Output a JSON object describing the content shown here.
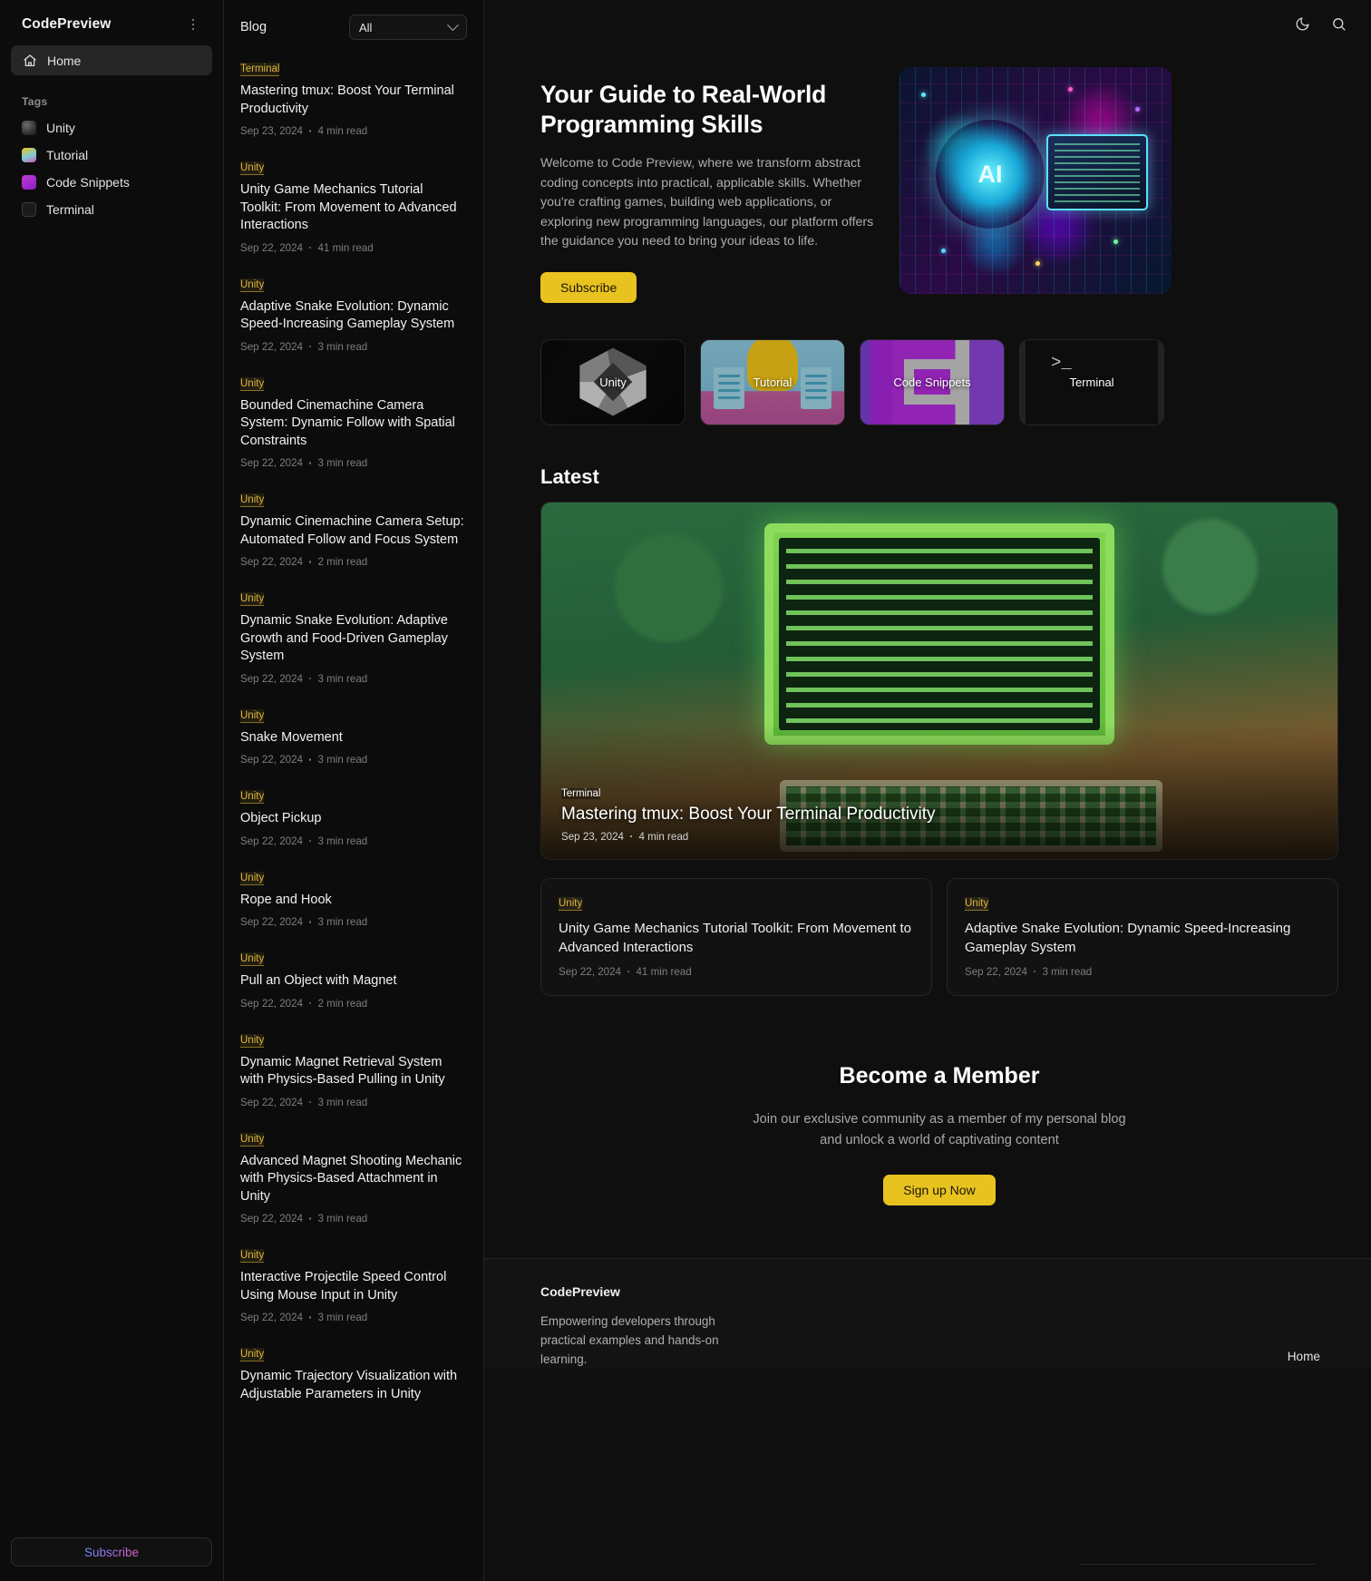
{
  "sidebar": {
    "brand": "CodePreview",
    "menu_icon": "kebab-menu-icon",
    "nav": [
      {
        "label": "Home",
        "icon": "home-icon",
        "active": true
      }
    ],
    "tags_header": "Tags",
    "tags": [
      {
        "label": "Unity",
        "icon": "unity-logo-icon"
      },
      {
        "label": "Tutorial",
        "icon": "tutorial-book-icon"
      },
      {
        "label": "Code Snippets",
        "icon": "code-snippets-icon"
      },
      {
        "label": "Terminal",
        "icon": "terminal-icon"
      }
    ],
    "subscribe_label": "Subscribe"
  },
  "list": {
    "title": "Blog",
    "filter_value": "All",
    "posts": [
      {
        "tag": "Terminal",
        "title": "Mastering tmux: Boost Your Terminal Productivity",
        "date": "Sep 23, 2024",
        "read": "4 min read"
      },
      {
        "tag": "Unity",
        "title": "Unity Game Mechanics Tutorial Toolkit: From Movement to Advanced Interactions",
        "date": "Sep 22, 2024",
        "read": "41 min read"
      },
      {
        "tag": "Unity",
        "title": "Adaptive Snake Evolution: Dynamic Speed-Increasing Gameplay System",
        "date": "Sep 22, 2024",
        "read": "3 min read"
      },
      {
        "tag": "Unity",
        "title": "Bounded Cinemachine Camera System: Dynamic Follow with Spatial Constraints",
        "date": "Sep 22, 2024",
        "read": "3 min read"
      },
      {
        "tag": "Unity",
        "title": "Dynamic Cinemachine Camera Setup: Automated Follow and Focus System",
        "date": "Sep 22, 2024",
        "read": "2 min read"
      },
      {
        "tag": "Unity",
        "title": "Dynamic Snake Evolution: Adaptive Growth and Food-Driven Gameplay System",
        "date": "Sep 22, 2024",
        "read": "3 min read"
      },
      {
        "tag": "Unity",
        "title": "Snake Movement",
        "date": "Sep 22, 2024",
        "read": "3 min read"
      },
      {
        "tag": "Unity",
        "title": "Object Pickup",
        "date": "Sep 22, 2024",
        "read": "3 min read"
      },
      {
        "tag": "Unity",
        "title": "Rope and Hook",
        "date": "Sep 22, 2024",
        "read": "3 min read"
      },
      {
        "tag": "Unity",
        "title": "Pull an Object with Magnet",
        "date": "Sep 22, 2024",
        "read": "2 min read"
      },
      {
        "tag": "Unity",
        "title": "Dynamic Magnet Retrieval System with Physics-Based Pulling in Unity",
        "date": "Sep 22, 2024",
        "read": "3 min read"
      },
      {
        "tag": "Unity",
        "title": "Advanced Magnet Shooting Mechanic with Physics-Based Attachment in Unity",
        "date": "Sep 22, 2024",
        "read": "3 min read"
      },
      {
        "tag": "Unity",
        "title": "Interactive Projectile Speed Control Using Mouse Input in Unity",
        "date": "Sep 22, 2024",
        "read": "3 min read"
      },
      {
        "tag": "Unity",
        "title": "Dynamic Trajectory Visualization with Adjustable Parameters in Unity",
        "date": "",
        "read": ""
      }
    ]
  },
  "topbar": {
    "theme_toggle": "moon-icon",
    "search": "search-icon"
  },
  "hero": {
    "title": "Your Guide to Real-World Programming Skills",
    "body": "Welcome to Code Preview, where we transform abstract coding concepts into practical, applicable skills. Whether you're crafting games, building web applications, or exploring new programming languages, our platform offers the guidance you need to bring your ideas to life.",
    "cta": "Subscribe",
    "art": "ai-neon-illustration"
  },
  "categories": [
    {
      "label": "Unity",
      "art": "unity-cube-art"
    },
    {
      "label": "Tutorial",
      "art": "tutorial-book-bulb-art"
    },
    {
      "label": "Code Snippets",
      "art": "code-brackets-art"
    },
    {
      "label": "Terminal",
      "art": "terminal-prompt-art"
    }
  ],
  "latest": {
    "heading": "Latest",
    "featured": {
      "tag": "Terminal",
      "title": "Mastering tmux: Boost Your Terminal Productivity",
      "date": "Sep 23, 2024",
      "read": "4 min read",
      "art": "retro-pixel-computer-art"
    },
    "cards": [
      {
        "tag": "Unity",
        "title": "Unity Game Mechanics Tutorial Toolkit: From Movement to Advanced Interactions",
        "date": "Sep 22, 2024",
        "read": "41 min read"
      },
      {
        "tag": "Unity",
        "title": "Adaptive Snake Evolution: Dynamic Speed-Increasing Gameplay System",
        "date": "Sep 22, 2024",
        "read": "3 min read"
      }
    ]
  },
  "member": {
    "heading": "Become a Member",
    "body": "Join our exclusive community as a member of my personal blog and unlock a world of captivating content",
    "cta": "Sign up Now"
  },
  "footer": {
    "brand": "CodePreview",
    "description": "Empowering developers through practical examples and hands-on learning.",
    "link": "Home"
  },
  "colors": {
    "accent_yellow": "#e8c320",
    "tag_gold": "#e0b63a",
    "background": "#0f0f0f",
    "panel": "#0c0c0c"
  }
}
